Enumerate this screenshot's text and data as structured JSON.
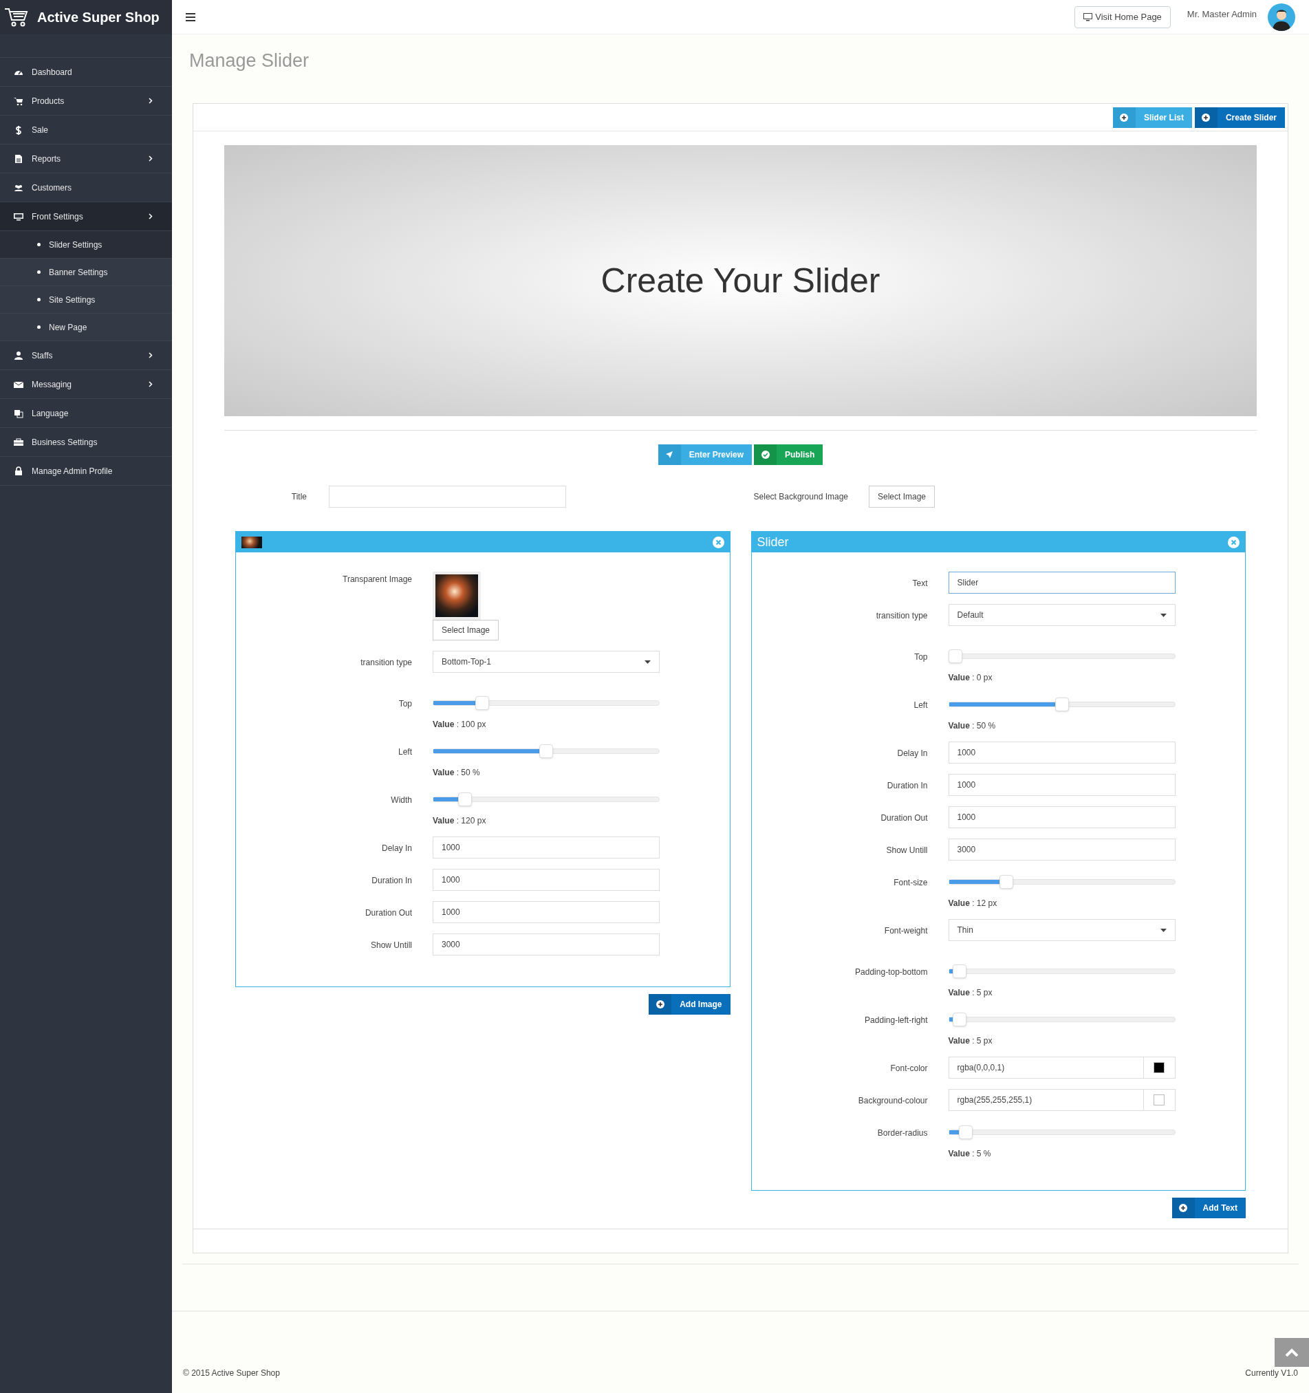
{
  "brand": {
    "name": "Active Super Shop"
  },
  "header": {
    "visit_button": "Visit Home Page",
    "user_name": "Mr. Master Admin"
  },
  "sidebar": {
    "items": [
      {
        "label": "Dashboard",
        "expandable": false,
        "selected": false
      },
      {
        "label": "Products",
        "expandable": true,
        "selected": false
      },
      {
        "label": "Sale",
        "expandable": false,
        "selected": false
      },
      {
        "label": "Reports",
        "expandable": true,
        "selected": false
      },
      {
        "label": "Customers",
        "expandable": false,
        "selected": false
      },
      {
        "label": "Front Settings",
        "expandable": true,
        "selected": true,
        "children": [
          {
            "label": "Slider Settings",
            "selected": true
          },
          {
            "label": "Banner Settings",
            "selected": false
          },
          {
            "label": "Site Settings",
            "selected": false
          },
          {
            "label": "New Page",
            "selected": false
          }
        ]
      },
      {
        "label": "Staffs",
        "expandable": true,
        "selected": false
      },
      {
        "label": "Messaging",
        "expandable": true,
        "selected": false
      },
      {
        "label": "Language",
        "expandable": false,
        "selected": false
      },
      {
        "label": "Business Settings",
        "expandable": false,
        "selected": false
      },
      {
        "label": "Manage Admin Profile",
        "expandable": false,
        "selected": false
      }
    ]
  },
  "page": {
    "title": "Manage Slider"
  },
  "card_buttons": [
    {
      "label": "Slider List",
      "kind": "info"
    },
    {
      "label": "Create Slider",
      "kind": "primary"
    }
  ],
  "preview": {
    "text": "Create Your Slider"
  },
  "preview_buttons": [
    {
      "label": "Enter Preview",
      "kind": "info"
    },
    {
      "label": "Publish",
      "kind": "success"
    }
  ],
  "title_field": {
    "label": "Title"
  },
  "background": {
    "label": "Select Background Image",
    "button": "Select Image"
  },
  "layers": [
    {
      "kind": "image",
      "add_button": "Add Image",
      "fields": [
        {
          "kind": "image",
          "label": "Transparent Image",
          "button": "Select Image"
        },
        {
          "kind": "select",
          "label": "transition type",
          "value": "Bottom-Top-1"
        },
        {
          "kind": "range",
          "label": "Top",
          "level": 0.2,
          "reading": "**Value** : 100 px"
        },
        {
          "kind": "range",
          "label": "Left",
          "level": 0.5,
          "reading": "**Value** : 50 %"
        },
        {
          "kind": "range",
          "label": "Width",
          "level": 0.12,
          "reading": "**Value** : 120 px"
        },
        {
          "kind": "input",
          "label": "Delay In",
          "value": "1000",
          "focused": false
        },
        {
          "kind": "input",
          "label": "Duration In",
          "value": "1000",
          "focused": false
        },
        {
          "kind": "input",
          "label": "Duration Out",
          "value": "1000",
          "focused": false
        },
        {
          "kind": "input",
          "label": "Show Untill",
          "value": "3000",
          "focused": false
        }
      ]
    },
    {
      "kind": "text",
      "title": "Slider",
      "add_button": "Add Text",
      "fields": [
        {
          "kind": "input",
          "label": "Text",
          "value": "Slider",
          "focused": true
        },
        {
          "kind": "select",
          "label": "transition type",
          "value": "Default"
        },
        {
          "kind": "range",
          "label": "Top",
          "level": 0,
          "reading": "**Value** : 0 px"
        },
        {
          "kind": "range",
          "label": "Left",
          "level": 0.5,
          "reading": "**Value** : 50 %"
        },
        {
          "kind": "input",
          "label": "Delay In",
          "value": "1000",
          "focused": false
        },
        {
          "kind": "input",
          "label": "Duration In",
          "value": "1000",
          "focused": false
        },
        {
          "kind": "input",
          "label": "Duration Out",
          "value": "1000",
          "focused": false
        },
        {
          "kind": "input",
          "label": "Show Untill",
          "value": "3000",
          "focused": false
        },
        {
          "kind": "range",
          "label": "Font-size",
          "level": 0.24,
          "reading": "**Value** : 12 px"
        },
        {
          "kind": "select",
          "label": "Font-weight",
          "value": "Thin"
        },
        {
          "kind": "range",
          "label": "Padding-top-bottom",
          "level": 0.02,
          "reading": "**Value** : 5 px"
        },
        {
          "kind": "range",
          "label": "Padding-left-right",
          "level": 0.02,
          "reading": "**Value** : 5 px"
        },
        {
          "kind": "color",
          "label": "Font-color",
          "value": "rgba(0,0,0,1)",
          "color": "#000000"
        },
        {
          "kind": "color",
          "label": "Background-colour",
          "value": "rgba(255,255,255,1)",
          "color": "#ffffff"
        },
        {
          "kind": "range",
          "label": "Border-radius",
          "level": 0.05,
          "reading": "**Value** : 5 %"
        }
      ]
    }
  ],
  "footer": {
    "copyright": "© 2015 Active Super Shop",
    "version": "Currently V1.0"
  }
}
